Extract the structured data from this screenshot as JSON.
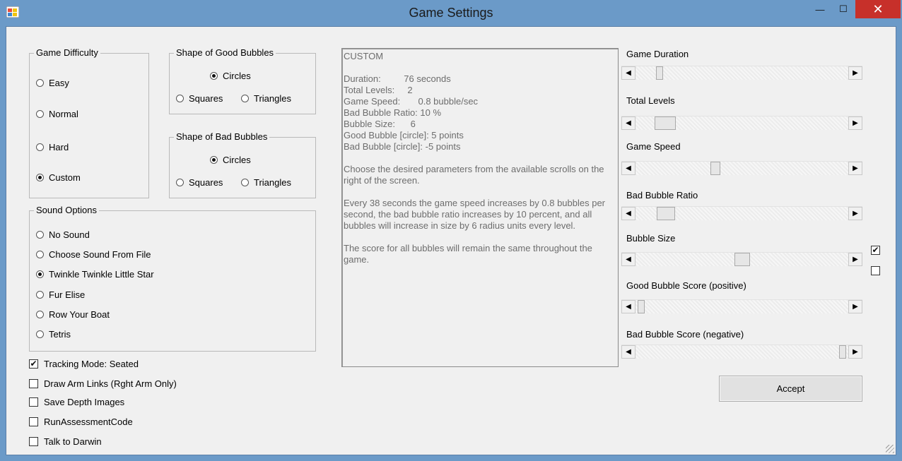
{
  "window": {
    "title": "Game Settings",
    "minimize": "—",
    "maximize": "☐",
    "close": "✕"
  },
  "difficulty": {
    "title": "Game Difficulty",
    "options": [
      {
        "label": "Easy",
        "selected": false
      },
      {
        "label": "Normal",
        "selected": false
      },
      {
        "label": "Hard",
        "selected": false
      },
      {
        "label": "Custom",
        "selected": true
      }
    ]
  },
  "good_shape": {
    "title": "Shape of Good Bubbles",
    "options": [
      {
        "label": "Circles",
        "selected": true
      },
      {
        "label": "Squares",
        "selected": false
      },
      {
        "label": "Triangles",
        "selected": false
      }
    ]
  },
  "bad_shape": {
    "title": "Shape of Bad Bubbles",
    "options": [
      {
        "label": "Circles",
        "selected": true
      },
      {
        "label": "Squares",
        "selected": false
      },
      {
        "label": "Triangles",
        "selected": false
      }
    ]
  },
  "sound": {
    "title": "Sound Options",
    "options": [
      {
        "label": "No Sound",
        "selected": false
      },
      {
        "label": "Choose Sound From File",
        "selected": false
      },
      {
        "label": "Twinkle Twinkle Little Star",
        "selected": true
      },
      {
        "label": "Fur Elise",
        "selected": false
      },
      {
        "label": "Row Your Boat",
        "selected": false
      },
      {
        "label": "Tetris",
        "selected": false
      }
    ]
  },
  "checkboxes": [
    {
      "label": "Tracking Mode: Seated",
      "checked": true
    },
    {
      "label": "Draw Arm Links (Rght Arm Only)",
      "checked": false
    },
    {
      "label": "Save Depth Images",
      "checked": false
    },
    {
      "label": "RunAssessmentCode",
      "checked": false
    },
    {
      "label": "Talk to Darwin",
      "checked": false
    }
  ],
  "summary": {
    "heading": "CUSTOM",
    "duration": "Duration:         76 seconds",
    "levels": "Total Levels:     2",
    "speed": "Game Speed:       0.8 bubble/sec",
    "ratio": "Bad Bubble Ratio: 10 %",
    "size": "Bubble Size:      6",
    "good_score": "Good Bubble [circle]: 5 points",
    "bad_score": "Bad Bubble [circle]: -5 points",
    "instructions": "Choose the desired parameters from the available scrolls on the right of the screen.",
    "progression": "Every 38 seconds the game speed increases by 0.8 bubbles per second, the bad bubble ratio increases by 10 percent, and all bubbles will increase in size by 6 radius units every level.",
    "score_note": "The score for all bubbles will remain the same throughout the game."
  },
  "sliders": [
    {
      "label": "Game Duration",
      "position": 0.1
    },
    {
      "label": "Total Levels",
      "position": 0.1
    },
    {
      "label": "Game Speed",
      "position": 0.37
    },
    {
      "label": "Bad Bubble Ratio",
      "position": 0.11
    },
    {
      "label": "Bubble Size",
      "position": 0.5
    },
    {
      "label": "Good Bubble Score (positive)",
      "position": 0.01
    },
    {
      "label": "Bad Bubble Score (negative)",
      "position": 0.99
    }
  ],
  "side_checks": [
    {
      "checked": true
    },
    {
      "checked": false
    }
  ],
  "accept_label": "Accept",
  "icons": {
    "scroll_left": "◀",
    "scroll_right": "▶",
    "check_mark": "✔"
  }
}
